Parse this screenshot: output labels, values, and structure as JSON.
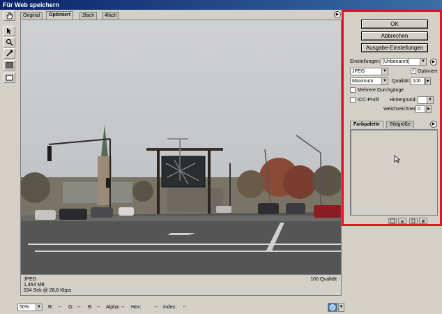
{
  "window": {
    "title": "Für Web speichern"
  },
  "tabs": [
    "Original",
    "Optimiert",
    "2fach",
    "4fach"
  ],
  "tools": [
    {
      "name": "hand-tool-icon"
    },
    {
      "name": "slice-select-tool-icon"
    },
    {
      "name": "zoom-tool-icon"
    },
    {
      "name": "eyedropper-tool-icon"
    }
  ],
  "image_info": {
    "format": "JPEG",
    "size": "1,464 MB",
    "time": "534 Sek @ 28,8 Kbps",
    "quality": "100 Qualität"
  },
  "buttons": {
    "ok": "OK",
    "cancel": "Abbrechen",
    "output": "Ausgabe-Einstellungen"
  },
  "settings": {
    "label": "Einstellungen:",
    "preset": "[Unbenannt]",
    "format": "JPEG",
    "optimized_label": "Optimiert",
    "optimized_checked": true,
    "quality_level": "Maximum",
    "quality_label": "Qualität:",
    "quality_value": "100",
    "progressive_label": "Mehrere Durchgänge",
    "icc_label": "ICC-Profil",
    "background_label": "Hintergrund:",
    "blur_label": "Weichzeichnen:",
    "blur_value": "0"
  },
  "palette_tabs": [
    "Farbpalette",
    "Bildgröße"
  ],
  "bottom": {
    "zoom": "50%",
    "r_label": "R:",
    "r_value": "--",
    "g_label": "G:",
    "g_value": "--",
    "b_label": "B:",
    "b_value": "--",
    "alpha_label": "Alpha:",
    "alpha_value": "--",
    "hex_label": "Hex:",
    "hex_value": "--",
    "index_label": "Index:",
    "index_value": "--"
  },
  "colors": {
    "highlight": "#e0141e",
    "titlebar": "#0a246a",
    "chrome": "#d4d0c8"
  }
}
